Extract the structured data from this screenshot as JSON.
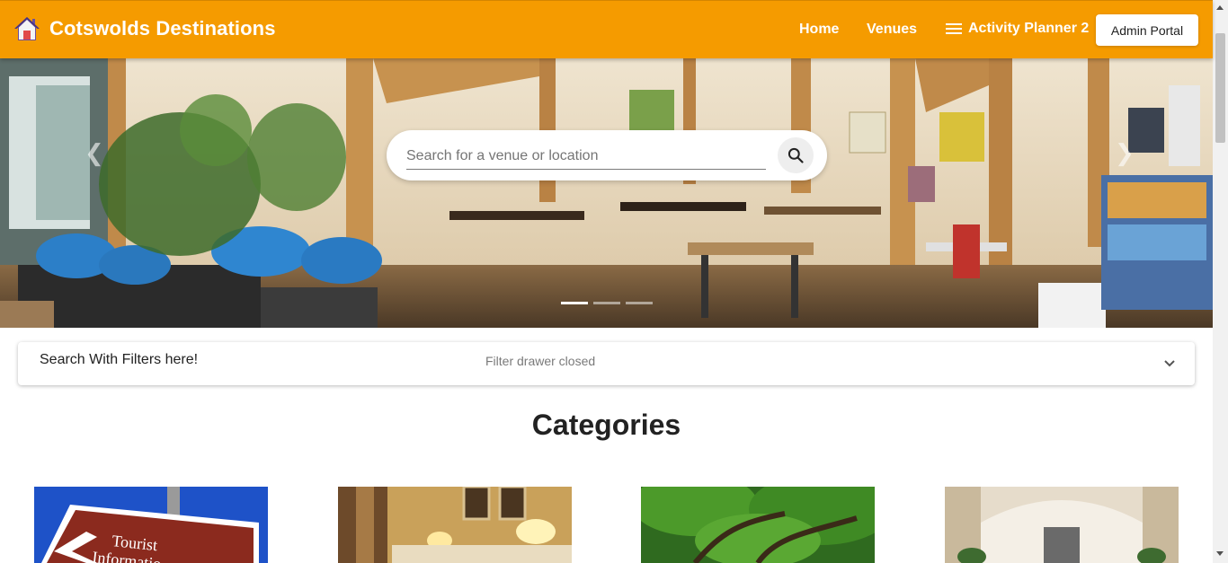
{
  "header": {
    "brand": "Cotswolds Destinations",
    "nav": {
      "home": "Home",
      "venues": "Venues",
      "planner": "Activity Planner 2"
    },
    "admin_button": "Admin Portal"
  },
  "hero": {
    "search_placeholder": "Search for a venue or location",
    "slide_count": 3,
    "active_slide": 1
  },
  "filter": {
    "title": "Search With Filters here!",
    "status": "Filter drawer closed"
  },
  "categories": {
    "heading": "Categories",
    "cards": [
      {
        "image_text": "Tourist Informatio"
      },
      {
        "image_text": ""
      },
      {
        "image_text": ""
      },
      {
        "image_text": ""
      }
    ]
  },
  "colors": {
    "appbar": "#f59b00",
    "white": "#ffffff"
  },
  "icons": {
    "logo": "house-icon",
    "menu": "menu-icon",
    "search": "search-icon",
    "chevron": "chevron-down-icon"
  }
}
